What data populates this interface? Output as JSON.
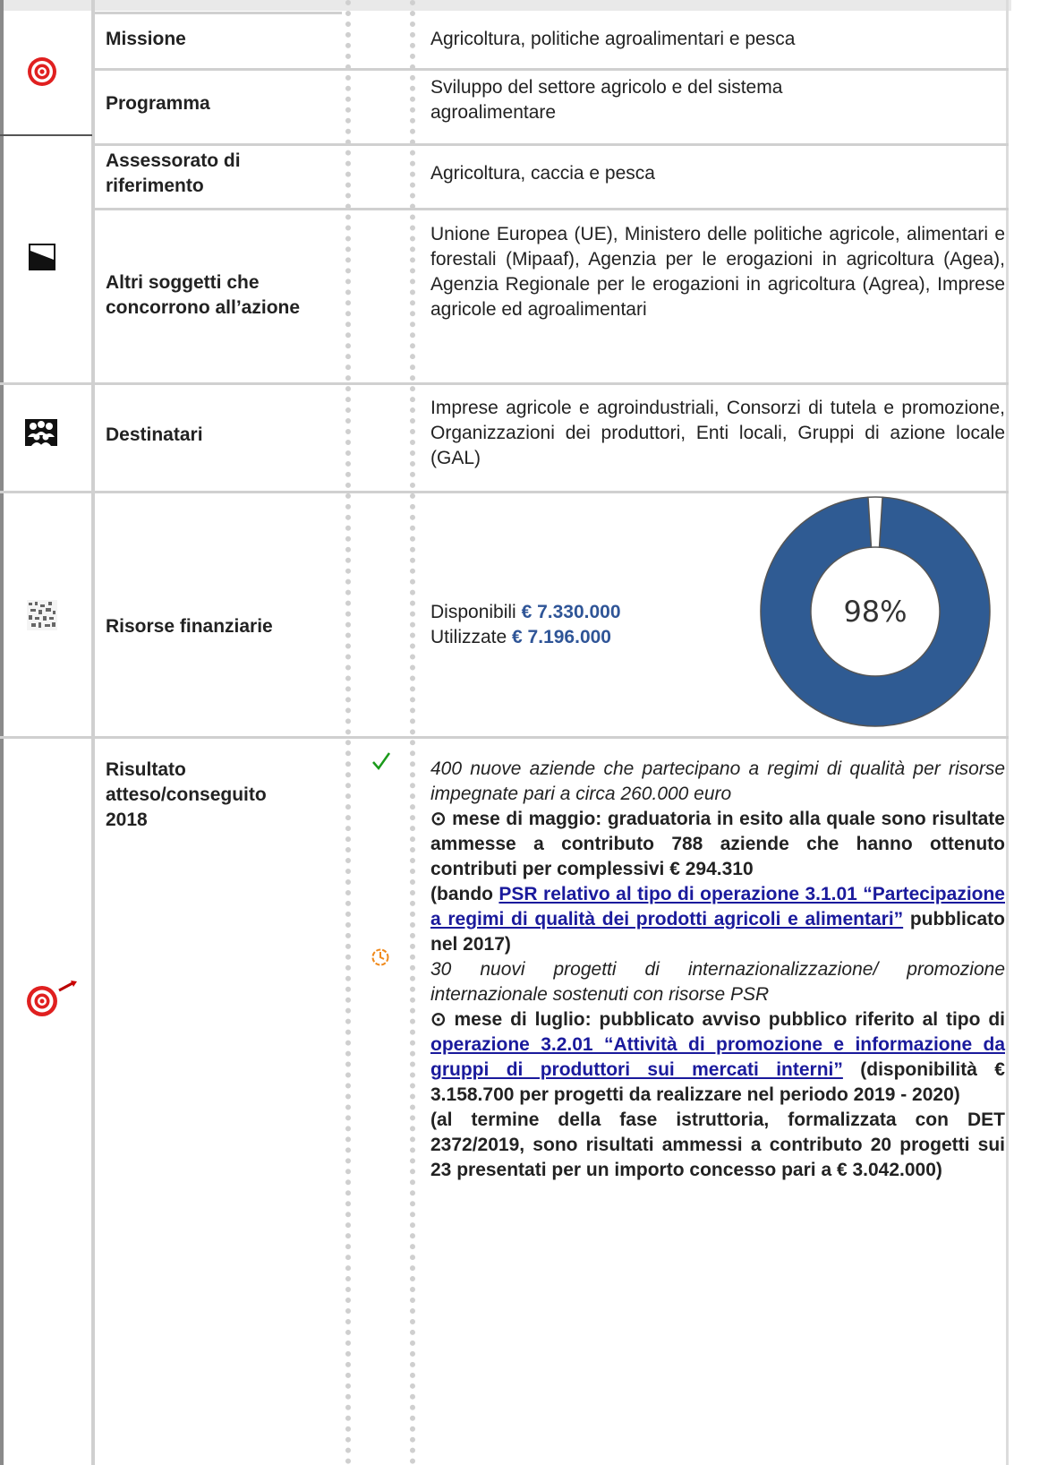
{
  "rows": {
    "missione": {
      "label": "Missione",
      "value": "Agricoltura, politiche agroalimentari e pesca"
    },
    "programma": {
      "label": "Programma",
      "value": "Sviluppo del settore agricolo e del sistema agroalimentare"
    },
    "assessorato": {
      "label": "Assessorato di riferimento",
      "value": "Agricoltura, caccia e pesca"
    },
    "altri": {
      "label": "Altri soggetti che concorrono all’azione",
      "value": "Unione Europea (UE), Ministero delle politiche agricole, alimentari e forestali (Mipaaf), Agenzia per le erogazioni in agricoltura (Agea), Agenzia Regionale per le erogazioni in agricoltura (Agrea), Imprese agricole ed agroalimentari"
    },
    "destinatari": {
      "label": "Destinatari",
      "value": "Imprese agricole e agroindustriali, Consorzi di tutela e promozione, Organizzazioni dei produttori, Enti locali, Gruppi di azione locale (GAL)"
    },
    "risorse": {
      "label": "Risorse finanziarie",
      "disponibili_label": "Disponibili",
      "disponibili_value": "€ 7.330.000",
      "utilizzate_label": "Utilizzate",
      "utilizzate_value": "€ 7.196.000"
    },
    "risultato": {
      "label": "Risultato atteso/conseguito 2018",
      "item1": {
        "status_icon": "check-icon",
        "target": "400 nuove aziende che partecipano a regimi di qualità per risorse impegnate pari a circa 260.000 euro",
        "bullet": "⊙",
        "text": "mese di maggio: graduatoria in esito alla quale sono risultate ammesse a contributo 788 aziende che hanno ottenuto contributi per complessivi € 294.310",
        "ref_open": "(bando ",
        "link": "PSR relativo al tipo di operazione 3.1.01 “Partecipazione a regimi di qualità dei prodotti agricoli e alimentari”",
        "ref_close": " pubblicato nel 2017)"
      },
      "item2": {
        "status_icon": "clock-icon",
        "target": "30 nuovi progetti di internazionalizzazione/ promozione internazionale sostenuti con risorse PSR",
        "bullet": "⊙",
        "text_a": "mese di luglio: pubblicato avviso pubblico riferito al tipo di ",
        "link": "operazione 3.2.01 “Attività di promozione e informazione da gruppi di produttori sui mercati interni”",
        "text_b": " (disponibilità € 3.158.700 per progetti da realizzare nel periodo 2019 - 2020)",
        "text_c": "(al termine della fase istruttoria, formalizzata con DET 2372/2019, sono risultati ammessi a contributo 20 progetti sui 23 presentati per un importo concesso pari a € 3.042.000)"
      }
    }
  },
  "chart_data": {
    "type": "pie",
    "style": "donut",
    "center_label": "98%",
    "values": [
      98,
      2
    ],
    "colors": [
      "#2f5b93",
      "#ffffff"
    ]
  },
  "colors": {
    "accent": "#2f5597",
    "link": "#1a1a9c",
    "donut": "#2f5b93",
    "target_red": "#e02020"
  }
}
